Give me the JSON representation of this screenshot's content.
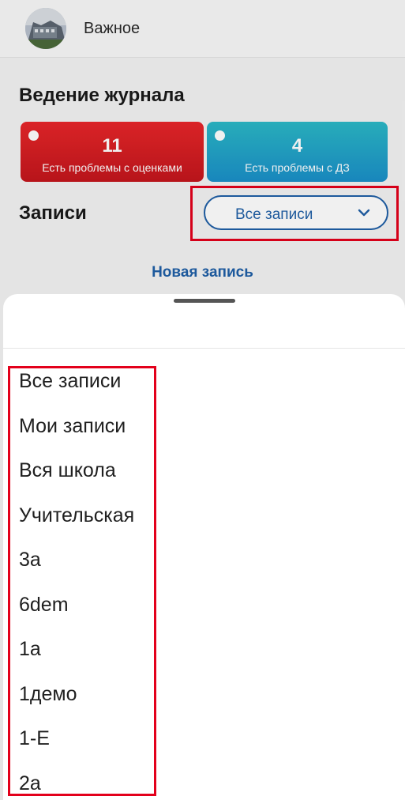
{
  "header": {
    "title": "Важное"
  },
  "journal": {
    "title": "Ведение журнала",
    "cards": [
      {
        "count": "11",
        "caption": "Есть проблемы с оценками",
        "color": "#d61f24"
      },
      {
        "count": "4",
        "caption": "Есть проблемы с ДЗ",
        "color": "#1e9ec8"
      }
    ]
  },
  "records": {
    "title": "Записи",
    "filter_value": "Все записи",
    "new_record_link": "Новая запись"
  },
  "sheet": {
    "options": [
      "Все записи",
      "Мои записи",
      "Вся школа",
      "Учительская",
      "3а",
      "6dem",
      "1а",
      "1демо",
      "1-Е",
      "2а"
    ]
  },
  "colors": {
    "accent": "#1f5fa6",
    "highlight": "#e3001b"
  }
}
